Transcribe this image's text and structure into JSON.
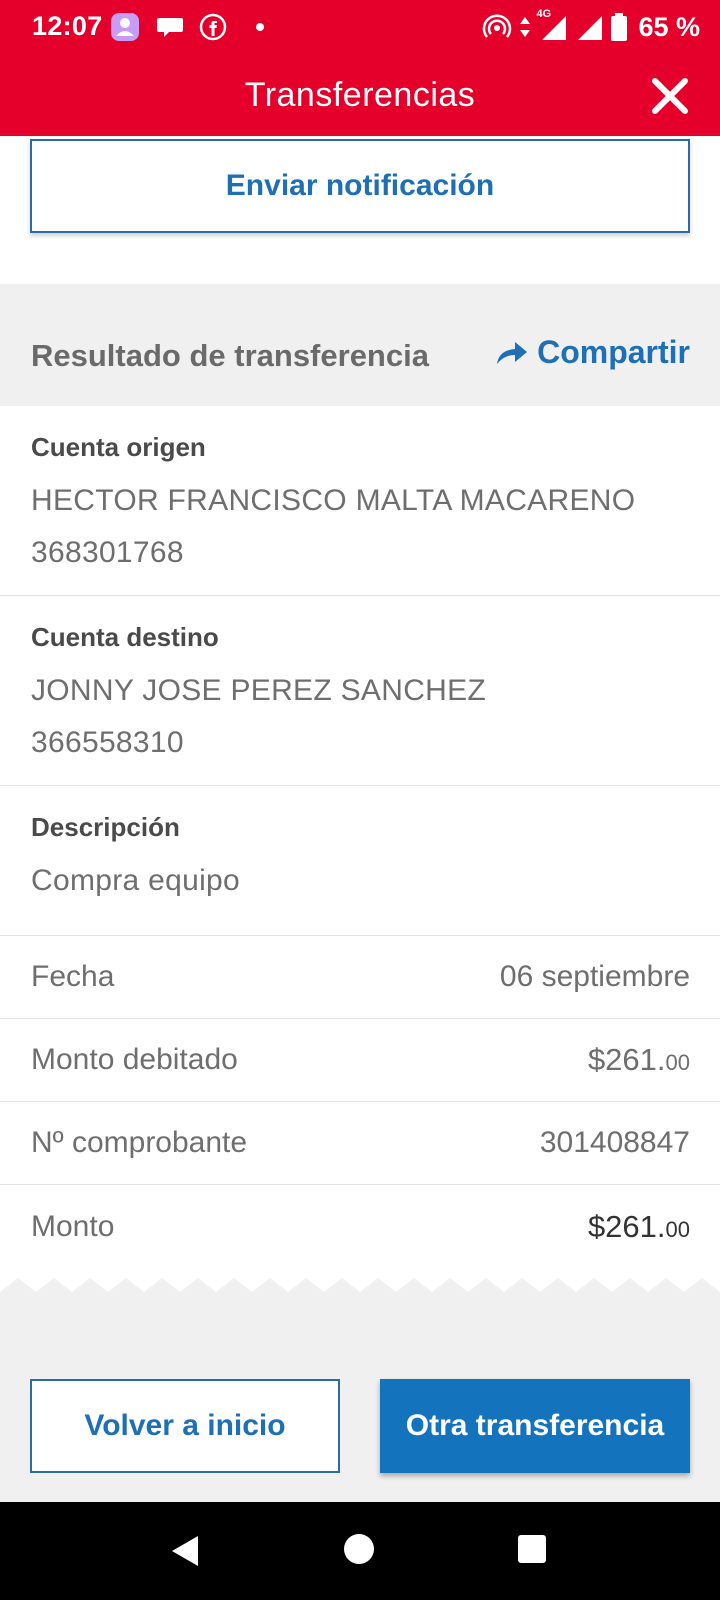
{
  "status_bar": {
    "time": "12:07",
    "network": "4G",
    "battery": "65 %",
    "icons": [
      "assistant-icon",
      "chat-icon",
      "facebook-icon",
      "notification-dot",
      "hotspot-icon",
      "data-arrows-icon",
      "signal-icon",
      "signal-icon",
      "battery-icon"
    ]
  },
  "app_bar": {
    "title": "Transferencias",
    "close_icon": "close-icon"
  },
  "notify_button": "Enviar notificación",
  "result": {
    "title": "Resultado de transferencia",
    "share_label": "Compartir",
    "share_icon": "share-arrow-icon"
  },
  "origin": {
    "label": "Cuenta origen",
    "name": "HECTOR FRANCISCO MALTA MACARENO",
    "number": "368301768"
  },
  "destination": {
    "label": "Cuenta destino",
    "name": "JONNY JOSE PEREZ SANCHEZ",
    "number": "366558310"
  },
  "description": {
    "label": "Descripción",
    "value": "Compra equipo"
  },
  "details": {
    "date_label": "Fecha",
    "date_value": "06 septiembre",
    "debited_label": "Monto debitado",
    "debited_whole": "$261.",
    "debited_cents": "00",
    "voucher_label": "Nº comprobante",
    "voucher_value": "301408847",
    "amount_label": "Monto",
    "amount_whole": "$261.",
    "amount_cents": "00"
  },
  "actions": {
    "home": "Volver a inicio",
    "other": "Otra transferencia"
  },
  "nav": [
    "back-icon",
    "home-icon",
    "recents-icon"
  ],
  "colors": {
    "brand_red": "#e4002b",
    "primary_blue": "#1473bd",
    "link_blue": "#1e6fb5",
    "background": "#f0f0f0"
  }
}
